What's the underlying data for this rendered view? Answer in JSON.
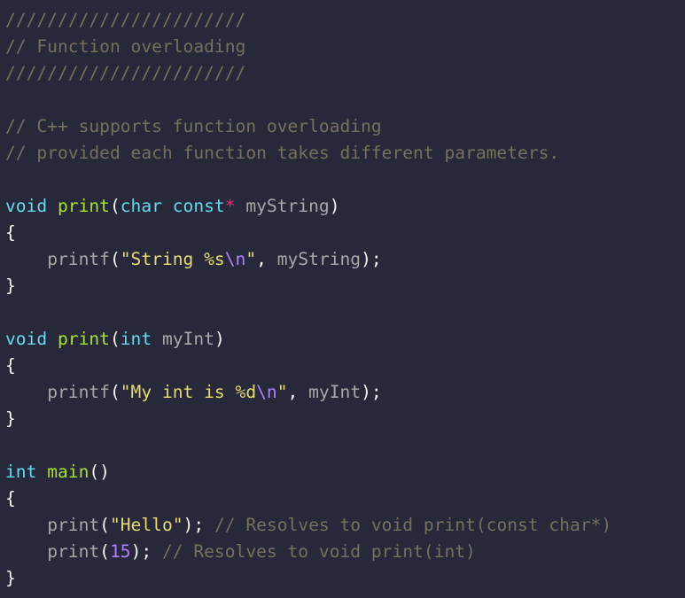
{
  "editor": {
    "language": "C++",
    "theme": {
      "background": "#272839",
      "comment": "#75715e",
      "keyword": "#66d9ef",
      "function": "#a6e22e",
      "string": "#e6db74",
      "escape_and_number": "#ae81ff",
      "operator": "#f92672",
      "identifier": "#a8a8a8",
      "plain": "#f8f8f2"
    },
    "lines": [
      [
        {
          "t": "comment",
          "v": "///////////////////////"
        }
      ],
      [
        {
          "t": "comment",
          "v": "// Function overloading"
        }
      ],
      [
        {
          "t": "comment",
          "v": "///////////////////////"
        }
      ],
      [],
      [
        {
          "t": "comment",
          "v": "// C++ supports function overloading"
        }
      ],
      [
        {
          "t": "comment",
          "v": "// provided each function takes different parameters."
        }
      ],
      [],
      [
        {
          "t": "keyword",
          "v": "void"
        },
        {
          "t": "plain",
          "v": " "
        },
        {
          "t": "func",
          "v": "print"
        },
        {
          "t": "plain",
          "v": "("
        },
        {
          "t": "keyword",
          "v": "char"
        },
        {
          "t": "plain",
          "v": " "
        },
        {
          "t": "keyword",
          "v": "const"
        },
        {
          "t": "op",
          "v": "*"
        },
        {
          "t": "plain",
          "v": " "
        },
        {
          "t": "param",
          "v": "myString"
        },
        {
          "t": "plain",
          "v": ")"
        }
      ],
      [
        {
          "t": "plain",
          "v": "{"
        }
      ],
      [
        {
          "t": "plain",
          "v": "    "
        },
        {
          "t": "callname",
          "v": "printf"
        },
        {
          "t": "plain",
          "v": "("
        },
        {
          "t": "string",
          "v": "\"String %s"
        },
        {
          "t": "escape",
          "v": "\\n"
        },
        {
          "t": "string",
          "v": "\""
        },
        {
          "t": "plain",
          "v": ", "
        },
        {
          "t": "param",
          "v": "myString"
        },
        {
          "t": "plain",
          "v": ");"
        }
      ],
      [
        {
          "t": "plain",
          "v": "}"
        }
      ],
      [],
      [
        {
          "t": "keyword",
          "v": "void"
        },
        {
          "t": "plain",
          "v": " "
        },
        {
          "t": "func",
          "v": "print"
        },
        {
          "t": "plain",
          "v": "("
        },
        {
          "t": "keyword",
          "v": "int"
        },
        {
          "t": "plain",
          "v": " "
        },
        {
          "t": "param",
          "v": "myInt"
        },
        {
          "t": "plain",
          "v": ")"
        }
      ],
      [
        {
          "t": "plain",
          "v": "{"
        }
      ],
      [
        {
          "t": "plain",
          "v": "    "
        },
        {
          "t": "callname",
          "v": "printf"
        },
        {
          "t": "plain",
          "v": "("
        },
        {
          "t": "string",
          "v": "\"My int is %d"
        },
        {
          "t": "escape",
          "v": "\\n"
        },
        {
          "t": "string",
          "v": "\""
        },
        {
          "t": "plain",
          "v": ", "
        },
        {
          "t": "param",
          "v": "myInt"
        },
        {
          "t": "plain",
          "v": ");"
        }
      ],
      [
        {
          "t": "plain",
          "v": "}"
        }
      ],
      [],
      [
        {
          "t": "keyword",
          "v": "int"
        },
        {
          "t": "plain",
          "v": " "
        },
        {
          "t": "func",
          "v": "main"
        },
        {
          "t": "plain",
          "v": "()"
        }
      ],
      [
        {
          "t": "plain",
          "v": "{"
        }
      ],
      [
        {
          "t": "plain",
          "v": "    "
        },
        {
          "t": "callname",
          "v": "print"
        },
        {
          "t": "plain",
          "v": "("
        },
        {
          "t": "string",
          "v": "\"Hello\""
        },
        {
          "t": "plain",
          "v": "); "
        },
        {
          "t": "comment",
          "v": "// Resolves to void print(const char*)"
        }
      ],
      [
        {
          "t": "plain",
          "v": "    "
        },
        {
          "t": "callname",
          "v": "print"
        },
        {
          "t": "plain",
          "v": "("
        },
        {
          "t": "number",
          "v": "15"
        },
        {
          "t": "plain",
          "v": "); "
        },
        {
          "t": "comment",
          "v": "// Resolves to void print(int)"
        }
      ],
      [
        {
          "t": "plain",
          "v": "}"
        }
      ]
    ]
  }
}
